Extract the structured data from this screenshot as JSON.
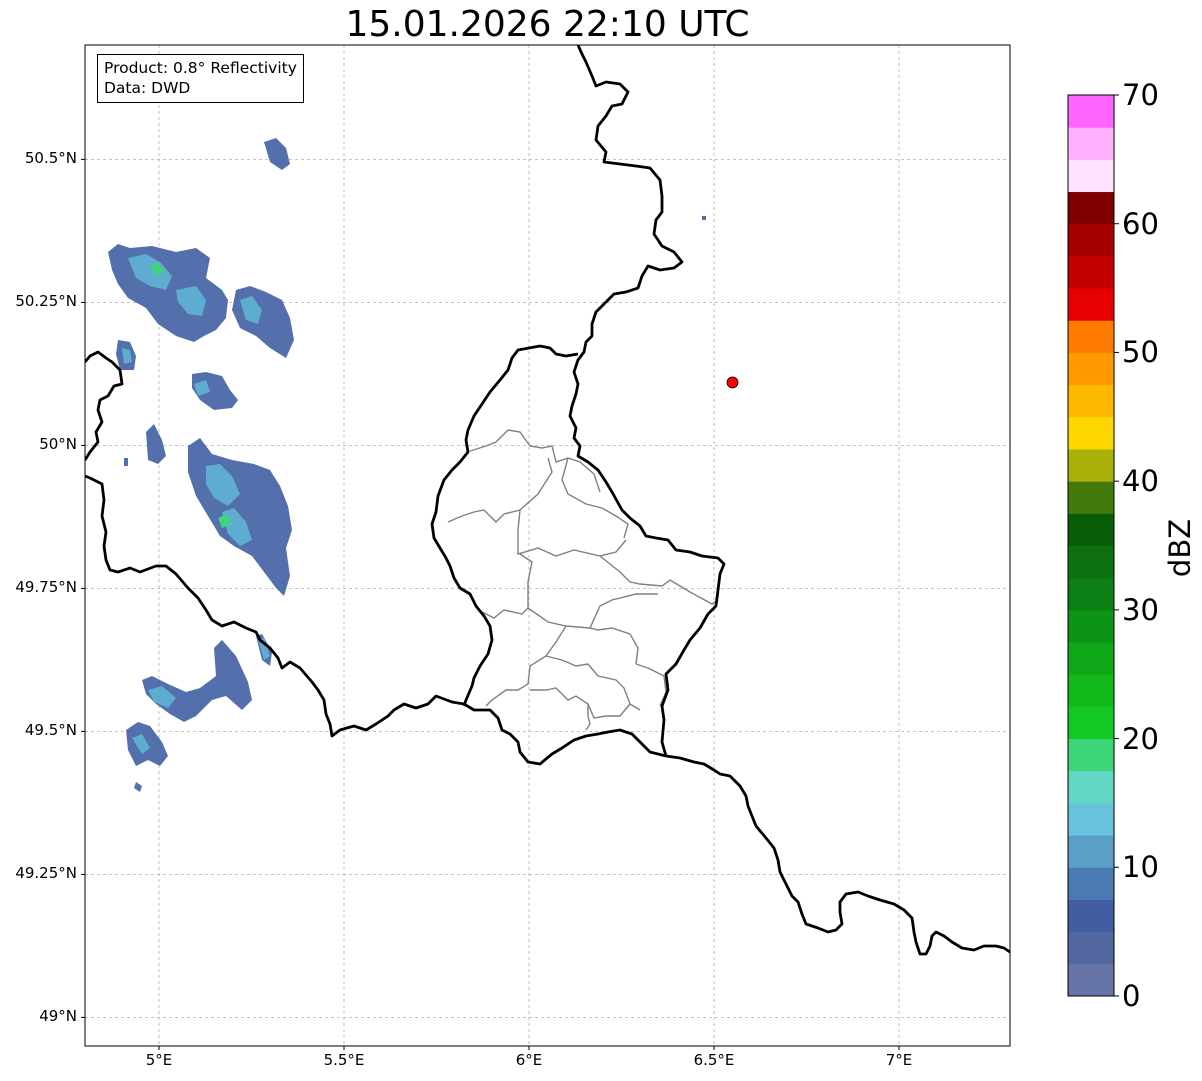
{
  "title": "15.01.2026 22:10 UTC",
  "info_box": {
    "product": "Product: 0.8° Reflectivity",
    "data_source": "Data: DWD"
  },
  "map": {
    "lon_range": [
      4.8,
      7.3
    ],
    "lat_range": [
      48.95,
      50.7
    ],
    "x_ticks": [
      {
        "value": 5.0,
        "label": "5°E"
      },
      {
        "value": 5.5,
        "label": "5.5°E"
      },
      {
        "value": 6.0,
        "label": "6°E"
      },
      {
        "value": 6.5,
        "label": "6.5°E"
      },
      {
        "value": 7.0,
        "label": "7°E"
      }
    ],
    "y_ticks": [
      {
        "value": 50.5,
        "label": "50.5°N"
      },
      {
        "value": 50.25,
        "label": "50.25°N"
      },
      {
        "value": 50.0,
        "label": "50°N"
      },
      {
        "value": 49.75,
        "label": "49.75°N"
      },
      {
        "value": 49.5,
        "label": "49.5°N"
      },
      {
        "value": 49.25,
        "label": "49.25°N"
      },
      {
        "value": 49.0,
        "label": "49°N"
      }
    ],
    "grid": true,
    "radar_site": {
      "lon": 6.55,
      "lat": 50.11,
      "color": "#ff0000"
    },
    "border_color": "#000000",
    "district_color": "#808080"
  },
  "colorbar": {
    "label": "dBZ",
    "min": 0,
    "max": 70,
    "step": 2.5,
    "ticks": [
      {
        "value": 70,
        "label": "70"
      },
      {
        "value": 60,
        "label": "60"
      },
      {
        "value": 50,
        "label": "50"
      },
      {
        "value": 40,
        "label": "40"
      },
      {
        "value": 30,
        "label": "30"
      },
      {
        "value": 20,
        "label": "20"
      },
      {
        "value": 10,
        "label": "10"
      },
      {
        "value": 0,
        "label": "0"
      }
    ],
    "colors": [
      "#6673a6",
      "#52679f",
      "#425da1",
      "#4b79b1",
      "#5b9fc6",
      "#69c3dc",
      "#63d6c4",
      "#3fd679",
      "#12c822",
      "#12b91b",
      "#10a818",
      "#0d9315",
      "#0c7f14",
      "#0c7010",
      "#085d09",
      "#447a0c",
      "#aab20a",
      "#ffd700",
      "#ffb800",
      "#ff9900",
      "#ff7b00",
      "#e60000",
      "#c40000",
      "#a60000",
      "#7f0000",
      "#ffe0ff",
      "#ffb0ff",
      "#ff66ff",
      "#ee33ee"
    ]
  }
}
